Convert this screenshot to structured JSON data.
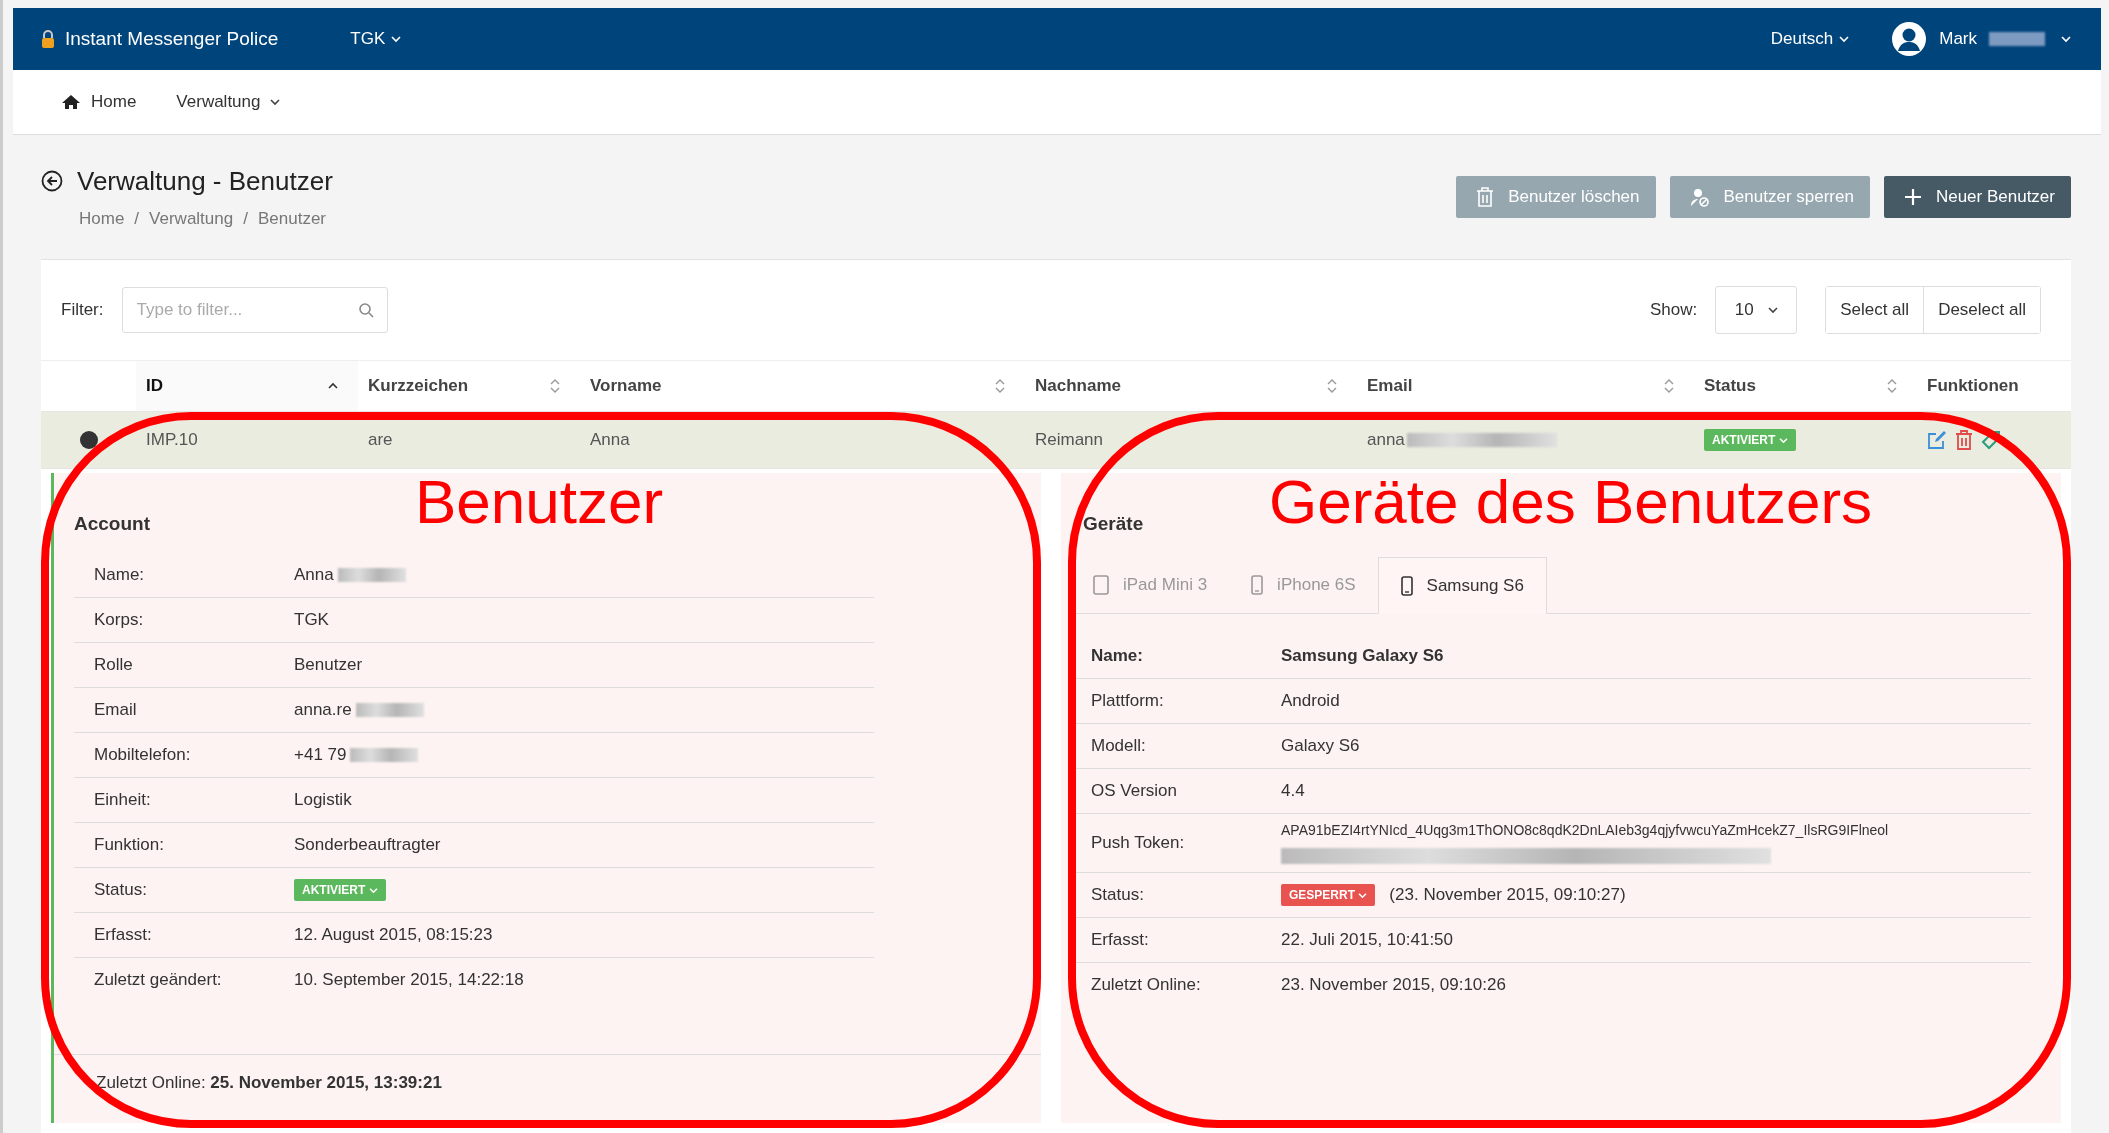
{
  "topbar": {
    "app_name": "Instant Messenger Police",
    "org_menu": "TGK",
    "language_menu": "Deutsch",
    "user_name": "Mark",
    "user_name_redacted": true
  },
  "nav": [
    {
      "label": "Home",
      "kind": "home"
    },
    {
      "label": "Verwaltung",
      "kind": "dropdown"
    }
  ],
  "page": {
    "title": "Verwaltung - Benutzer",
    "breadcrumb_separator": "/",
    "breadcrumb": [
      "Home",
      "Verwaltung",
      "Benutzer"
    ]
  },
  "actions": [
    {
      "label": "Benutzer löschen",
      "kind": "delete",
      "disabled": true
    },
    {
      "label": "Benutzer sperren",
      "kind": "lock",
      "disabled": true
    },
    {
      "label": "Neuer Benutzer",
      "kind": "add",
      "disabled": false
    }
  ],
  "filter": {
    "label": "Filter:",
    "placeholder": "Type to filter..."
  },
  "show": {
    "label": "Show:",
    "value": "10"
  },
  "selection_buttons": [
    "Select all",
    "Deselect all"
  ],
  "table": {
    "columns": [
      {
        "label": "ID",
        "sortable": true,
        "sorted": true
      },
      {
        "label": "Kurzzeichen",
        "sortable": true,
        "sorted": false
      },
      {
        "label": "Vorname",
        "sortable": true,
        "sorted": false
      },
      {
        "label": "Nachname",
        "sortable": true,
        "sorted": false
      },
      {
        "label": "Email",
        "sortable": true,
        "sorted": false
      },
      {
        "label": "Status",
        "sortable": true,
        "sorted": false
      },
      {
        "label": "Funktionen",
        "sortable": false,
        "sorted": false
      }
    ],
    "rows": [
      {
        "expanded": true,
        "cells": [
          "IMP.10",
          "are",
          "Anna",
          "Reimann",
          "anna"
        ],
        "email_redacted": true,
        "status": {
          "label": "AKTIVIERT",
          "color": "#5cb85c"
        }
      }
    ]
  },
  "account": {
    "heading": "Account",
    "fields": [
      {
        "label": "Name:",
        "value": "Anna",
        "redacted": true
      },
      {
        "label": "Korps:",
        "value": "TGK",
        "redacted": false
      },
      {
        "label": "Rolle",
        "value": "Benutzer",
        "redacted": false
      },
      {
        "label": "Email",
        "value": "anna.re",
        "redacted": true
      },
      {
        "label": "Mobiltelefon:",
        "value": "+41 79",
        "redacted": true
      },
      {
        "label": "Einheit:",
        "value": "Logistik",
        "redacted": false
      },
      {
        "label": "Funktion:",
        "value": "Sonderbeauftragter",
        "redacted": false
      },
      {
        "label": "Status:",
        "badge": {
          "label": "AKTIVIERT",
          "color": "#5cb85c"
        },
        "redacted": false
      },
      {
        "label": "Erfasst:",
        "value": "12. August 2015, 08:15:23",
        "redacted": false
      },
      {
        "label": "Zuletzt geändert:",
        "value": "10. September 2015, 14:22:18",
        "redacted": false
      }
    ],
    "footer": "Zuletzt Online: **25. November 2015, 13:39:21**"
  },
  "devices": {
    "heading": "Geräte",
    "tabs": [
      {
        "label": "iPad Mini 3",
        "kind": "tablet",
        "selected": false
      },
      {
        "label": "iPhone 6S",
        "kind": "phone",
        "selected": false
      },
      {
        "label": "Samsung S6",
        "kind": "phone",
        "selected": true
      }
    ],
    "fields": [
      {
        "label": "Name:",
        "value": "Samsung Galaxy S6",
        "redacted": false
      },
      {
        "label": "Plattform:",
        "value": "Android",
        "redacted": false
      },
      {
        "label": "Modell:",
        "value": "Galaxy S6",
        "redacted": false
      },
      {
        "label": "OS Version",
        "value": "4.4",
        "redacted": false
      },
      {
        "label": "Push Token:",
        "value": "APA91bEZI4rtYNIcd_4Uqg3m1ThONO8c8qdK2DnLAIeb3g4qjyfvwcuYaZmHcekZ7_IlsRG9IFlneol",
        "redacted": true
      },
      {
        "label": "Status:",
        "badge": {
          "label": "GESPERRT",
          "color": "#e8524f"
        },
        "note": "(23. November 2015, 09:10:27)",
        "redacted": false
      },
      {
        "label": "Erfasst:",
        "value": "22. Juli 2015, 10:41:50",
        "redacted": false
      },
      {
        "label": "Zuletzt Online:",
        "value": "23. November 2015, 09:10:26",
        "redacted": false
      }
    ]
  },
  "annotations": [
    {
      "label": "Benutzer"
    },
    {
      "label": "Geräte des Benutzers"
    }
  ]
}
